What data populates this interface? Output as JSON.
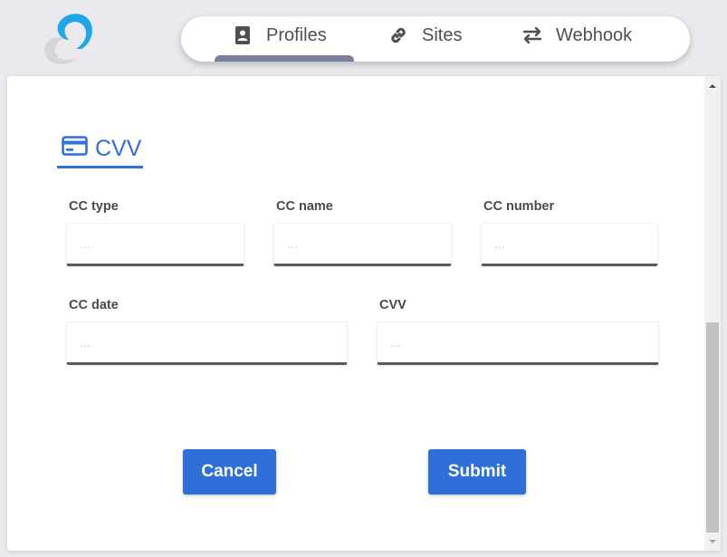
{
  "nav": {
    "tabs": [
      {
        "label": "Profiles",
        "icon": "contact-card-icon",
        "active": true
      },
      {
        "label": "Sites",
        "icon": "link-icon",
        "active": false
      },
      {
        "label": "Webhook",
        "icon": "swap-arrows-icon",
        "active": false
      }
    ]
  },
  "section": {
    "title": "CVV",
    "icon": "credit-card-icon"
  },
  "form": {
    "fields": [
      {
        "label": "CC type",
        "value": "",
        "placeholder": "..."
      },
      {
        "label": "CC name",
        "value": "",
        "placeholder": "..."
      },
      {
        "label": "CC number",
        "value": "",
        "placeholder": "..."
      },
      {
        "label": "CC date",
        "value": "",
        "placeholder": "..."
      },
      {
        "label": "CVV",
        "value": "",
        "placeholder": "..."
      }
    ]
  },
  "actions": {
    "cancel_label": "Cancel",
    "submit_label": "Submit"
  },
  "colors": {
    "accent": "#2e6fd8",
    "logo_blue": "#1ea7e8",
    "tab_indicator": "#7b7f9f"
  }
}
